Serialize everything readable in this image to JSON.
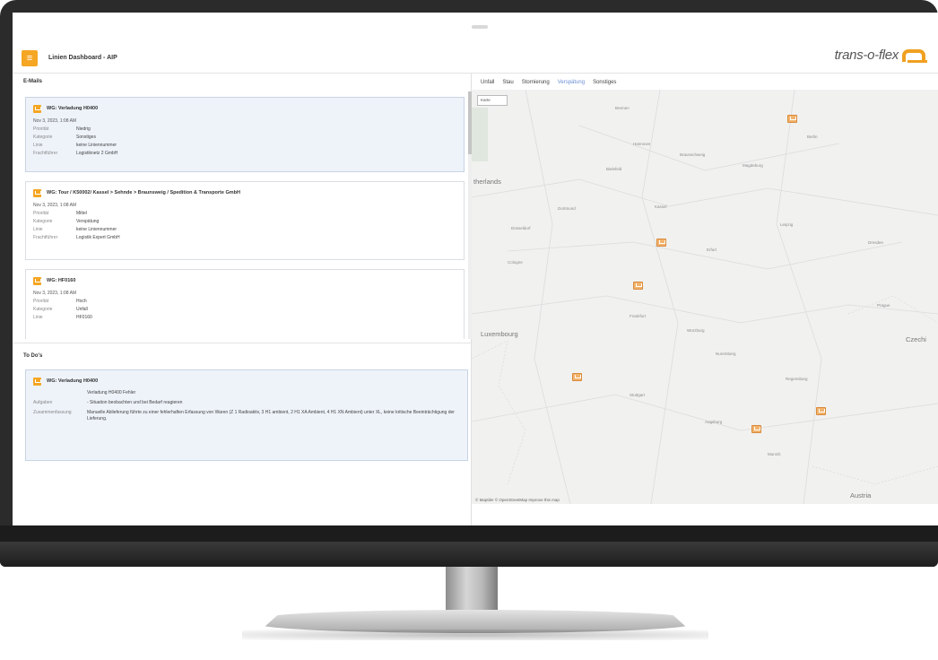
{
  "app": {
    "title": "Linien Dashboard - AIP",
    "brand": "trans-o-flex"
  },
  "emails": {
    "section_label": "E-Mails",
    "field_labels": {
      "priority": "Priorität",
      "category": "Kategorie",
      "line": "Linie",
      "carrier": "Frachtführer"
    },
    "items": [
      {
        "subject": "WG: Verladung H0400",
        "date": "Nov 3, 2023, 1:08 AM",
        "priority": "Niedrig",
        "category": "Sonstiges",
        "line": "keine Liniennummer",
        "carrier": "Logistiknetz 2 GmbH",
        "selected": true
      },
      {
        "subject": "WG: Tour / K50002/ Kassel > Sehnde > Braunsweig / Spedition & Transporte GmbH",
        "date": "Nov 3, 2023, 1:08 AM",
        "priority": "Mittel",
        "category": "Verspätung",
        "line": "keine Liniennummer",
        "carrier": "Logistik Expert GmbH",
        "selected": false
      },
      {
        "subject": "WG: HF0160",
        "date": "Nov 3, 2023, 1:08 AM",
        "priority": "Hoch",
        "category": "Unfall",
        "line": "HF0160",
        "carrier": "",
        "selected": false
      }
    ]
  },
  "todos": {
    "section_label": "To Do's",
    "field_labels": {
      "tasks": "Aufgaben",
      "summary": "Zusammenfassung"
    },
    "item": {
      "title": "WG: Verladung H0400",
      "subtitle": "Verladung H0400 Fehler",
      "tasks": "- Situation beobachten und bei Bedarf reagieren",
      "summary": "Manuelle Ablieferung führte zu einer fehlerhaften Erfassung von Waren (Z 1 Radioaktiv, 3 H1 ambient, 2 H1 XA Ambient, 4 H1 XN Ambient) unter XL, keine kritische Beeinträchtigung der Lieferung."
    }
  },
  "map_panel": {
    "tabs": [
      "Unfall",
      "Stau",
      "Stornierung",
      "Verspätung",
      "Sonstiges"
    ],
    "active_tab": "Verspätung",
    "layer_button": "Karte",
    "attribution": "© Maptiler © OpenStreetMap Improve this map",
    "accent_color": "#f5a623",
    "cities": [
      {
        "name": "Bremen"
      },
      {
        "name": "Berlin"
      },
      {
        "name": "Hannover"
      },
      {
        "name": "Braunschweig"
      },
      {
        "name": "Magdeburg"
      },
      {
        "name": "Bielefeld"
      },
      {
        "name": "therlands"
      },
      {
        "name": "Dortmund"
      },
      {
        "name": "Düsseldorf"
      },
      {
        "name": "Kassel"
      },
      {
        "name": "Leipzig"
      },
      {
        "name": "Cologne"
      },
      {
        "name": "Erfurt"
      },
      {
        "name": "Dresden"
      },
      {
        "name": "Frankfurt"
      },
      {
        "name": "Prague"
      },
      {
        "name": "Luxembourg"
      },
      {
        "name": "Würzburg"
      },
      {
        "name": "Czechi"
      },
      {
        "name": "Nuremberg"
      },
      {
        "name": "Stuttgart"
      },
      {
        "name": "Regensburg"
      },
      {
        "name": "Augsburg"
      },
      {
        "name": "Munich"
      },
      {
        "name": "Austria"
      }
    ]
  }
}
